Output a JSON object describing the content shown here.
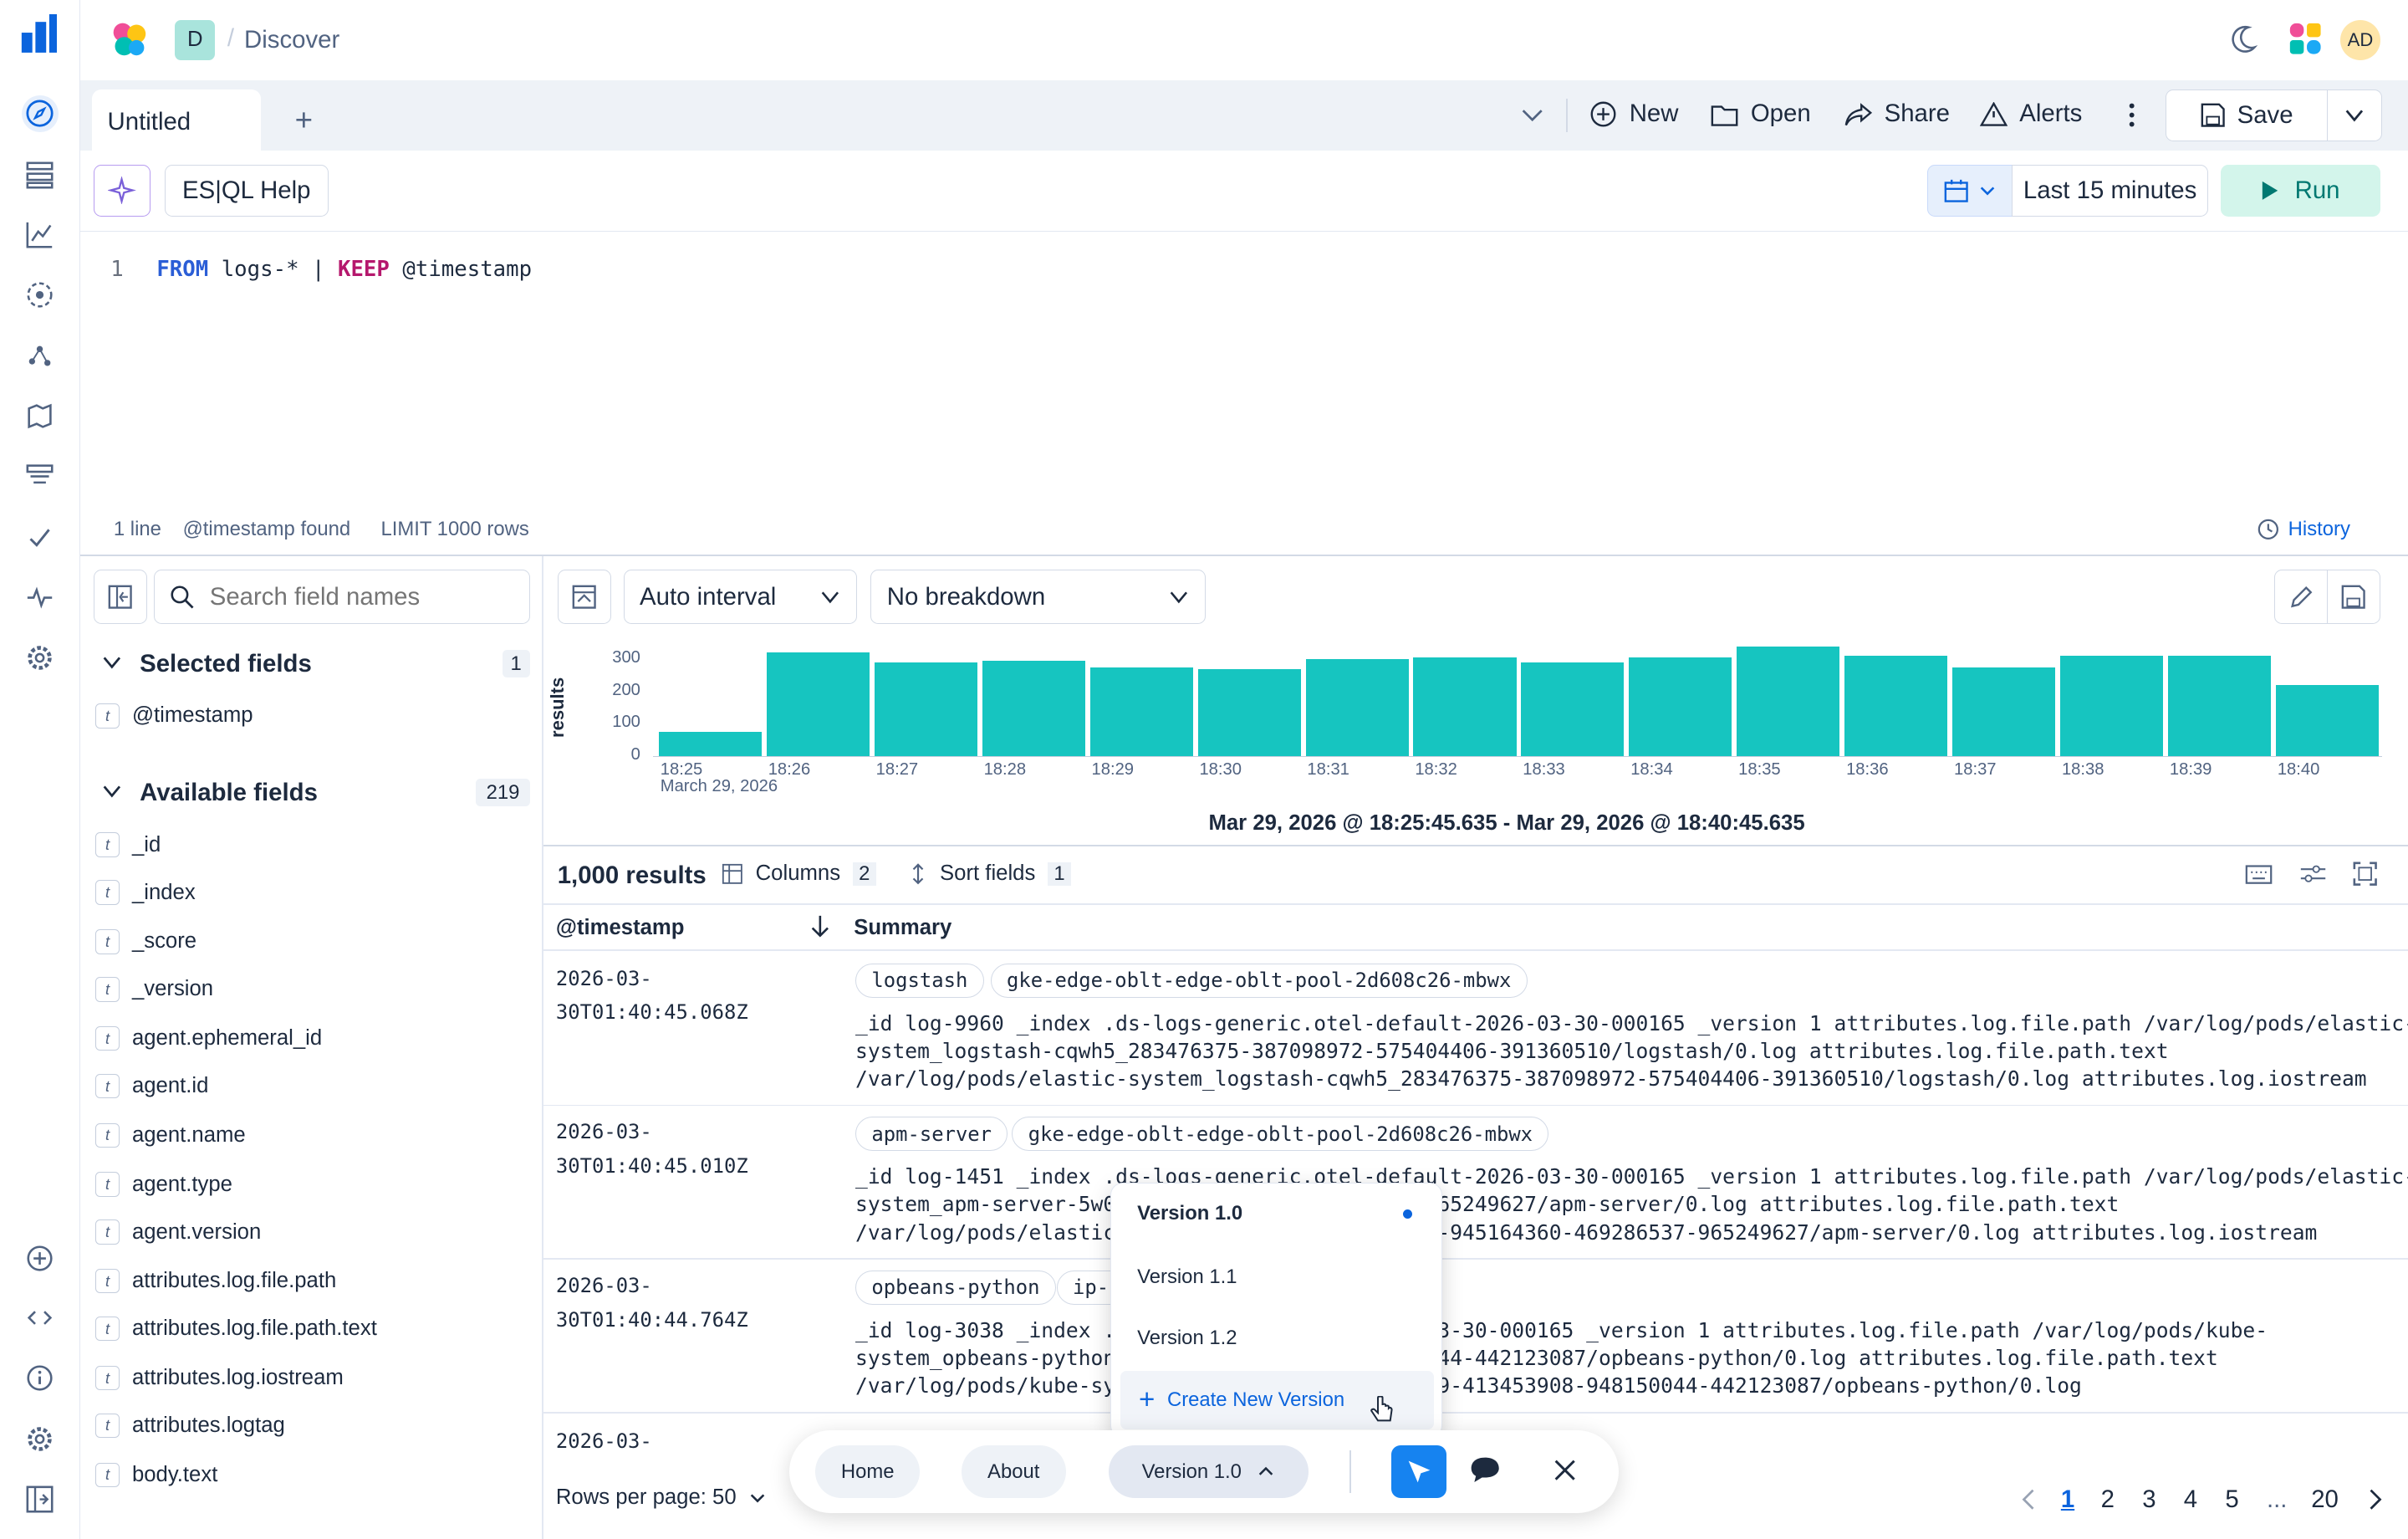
{
  "app": {
    "breadcrumb_initial": "D",
    "breadcrumb": "Discover",
    "user_initials": "AD"
  },
  "tabs": {
    "current": "Untitled"
  },
  "toolbar": {
    "new": "New",
    "open": "Open",
    "share": "Share",
    "alerts": "Alerts",
    "save": "Save"
  },
  "query": {
    "help": "ES|QL Help",
    "time": "Last 15 minutes",
    "run": "Run",
    "line_no": "1",
    "kw1": "FROM",
    "src": " logs-* | ",
    "kw2": "KEEP",
    "field": " @timestamp",
    "status_lines": "1 line",
    "status_found": "@timestamp found",
    "status_limit": "LIMIT 1000 rows",
    "history": "History"
  },
  "sidebar": {
    "search_placeholder": "Search field names",
    "selected_title": "Selected fields",
    "selected_count": "1",
    "selected": [
      "@timestamp"
    ],
    "available_title": "Available fields",
    "available_count": "219",
    "available": [
      "_id",
      "_index",
      "_score",
      "_version",
      "agent.ephemeral_id",
      "agent.id",
      "agent.name",
      "agent.type",
      "agent.version",
      "attributes.log.file.path",
      "attributes.log.file.path.text",
      "attributes.log.iostream",
      "attributes.logtag",
      "body.text"
    ]
  },
  "histogram": {
    "interval": "Auto interval",
    "breakdown": "No breakdown",
    "range": "Mar 29, 2026 @ 18:25:45.635 - Mar 29, 2026 @ 18:40:45.635",
    "date_label": "March 29, 2026"
  },
  "chart_data": {
    "type": "bar",
    "ylabel": "results",
    "ylim": [
      0,
      300
    ],
    "yticks": [
      "300",
      "200",
      "100",
      "0"
    ],
    "categories": [
      "18:25",
      "18:26",
      "18:27",
      "18:28",
      "18:29",
      "18:30",
      "18:31",
      "18:32",
      "18:33",
      "18:34",
      "18:35",
      "18:36",
      "18:37",
      "18:38",
      "18:39",
      "18:40"
    ],
    "values": [
      75,
      320,
      290,
      295,
      275,
      270,
      300,
      305,
      290,
      305,
      340,
      310,
      275,
      310,
      310,
      220
    ]
  },
  "table": {
    "results": "1,000 results",
    "columns_label": "Columns",
    "columns_count": "2",
    "sort_label": "Sort fields",
    "sort_count": "1",
    "col_timestamp": "@timestamp",
    "col_summary": "Summary",
    "rows": [
      {
        "ts1": "2026-03-",
        "ts2": "30T01:40:45.068Z",
        "tag1": "logstash",
        "tag2": "gke-edge-oblt-edge-oblt-pool-2d608c26-mbwx",
        "l1": "_id log-9960 _index .ds-logs-generic.otel-default-2026-03-30-000165 _version 1 attributes.log.file.path /var/log/pods/elastic-",
        "l2": "system_logstash-cqwh5_283476375-387098972-575404406-391360510/logstash/0.log attributes.log.file.path.text",
        "l3": "/var/log/pods/elastic-system_logstash-cqwh5_283476375-387098972-575404406-391360510/logstash/0.log attributes.log.iostream"
      },
      {
        "ts1": "2026-03-",
        "ts2": "30T01:40:45.010Z",
        "tag1": "apm-server",
        "tag2": "gke-edge-oblt-edge-oblt-pool-2d608c26-mbwx",
        "l1": "_id log-1451 _index .ds-logs-generic.otel-default-2026-03-30-000165 _version 1 attributes.log.file.path /var/log/pods/elastic-",
        "l2": "system_apm-server-5w0                    6537-965249627/apm-server/0.log attributes.log.file.path.text",
        "l3": "/var/log/pods/elastic                    211327-945164360-469286537-965249627/apm-server/0.log attributes.log.iostream"
      },
      {
        "ts1": "2026-03-",
        "ts2": "30T01:40:44.764Z",
        "tag1": "opbeans-python",
        "tag2": "ip-1",
        "l1": "_id log-3038 _index .                   -2026-03-30-000165 _version 1 attributes.log.file.path /var/log/pods/kube-",
        "l2": "system_opbeans-python                    48150044-442123087/opbeans-python/0.log attributes.log.file.path.text",
        "l3": "/var/log/pods/kube-sy                    6005219-413453908-948150044-442123087/opbeans-python/0.log"
      },
      {
        "ts1": "2026-03-"
      }
    ]
  },
  "footer": {
    "rows_per_page": "Rows per page: 50",
    "pages": [
      "1",
      "2",
      "3",
      "4",
      "5",
      "...",
      "20"
    ]
  },
  "toolbar_overlay": {
    "home": "Home",
    "about": "About",
    "version": "Version 1.0"
  },
  "version_menu": {
    "items": [
      "Version 1.0",
      "Version 1.1",
      "Version 1.2"
    ],
    "create": "Create New Version"
  },
  "colors": {
    "accent": "#0b64dd",
    "bar": "#16c5c0",
    "run_bg": "#d3f5eb",
    "run_text": "#007871"
  }
}
